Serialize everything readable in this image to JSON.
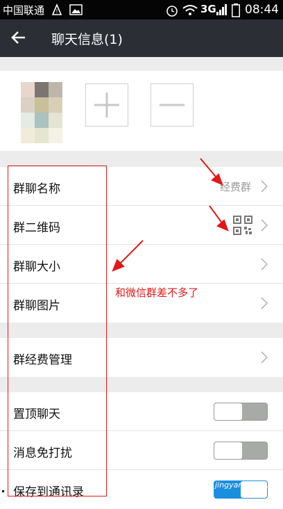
{
  "status_bar": {
    "carrier": "中国联通",
    "network": "3G",
    "time": "08:44"
  },
  "header": {
    "title": "聊天信息(1)"
  },
  "settings_group1": [
    {
      "label": "群聊名称",
      "value": "经费群"
    },
    {
      "label": "群二维码"
    },
    {
      "label": "群聊大小"
    },
    {
      "label": "群聊图片"
    }
  ],
  "settings_group2": [
    {
      "label": "群经费管理"
    }
  ],
  "settings_group3": [
    {
      "label": "置顶聊天",
      "toggle": "off"
    },
    {
      "label": "消息免打扰",
      "toggle": "off"
    },
    {
      "label": "保存到通讯录",
      "toggle": "on"
    }
  ],
  "annotation": {
    "text": "和微信群差不多了"
  },
  "watermark": {
    "text": "jingyan.baidu.com"
  },
  "colors": {
    "title_bar": "#2b2e34",
    "annotation": "#e01818",
    "toggle_off": "#a8aaa8",
    "toggle_on": "#1a8fe0"
  }
}
